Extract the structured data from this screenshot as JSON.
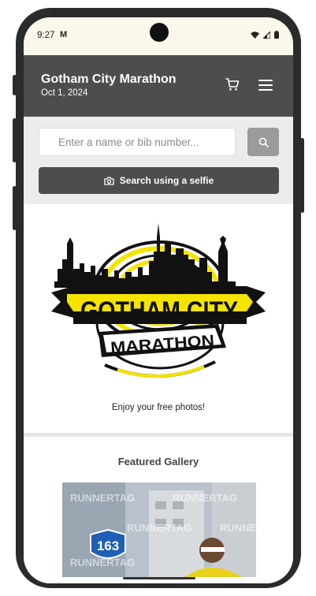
{
  "status": {
    "time": "9:27",
    "mail_icon": "M"
  },
  "header": {
    "title": "Gotham City Marathon",
    "date": "Oct 1, 2024",
    "cart_icon": "cart-icon",
    "menu_icon": "hamburger-menu-icon"
  },
  "search": {
    "placeholder": "Enter a name or bib number...",
    "value": "",
    "selfie_label": "Search using a selfie"
  },
  "hero": {
    "logo_line1": "GOTHAM CITY",
    "logo_line2": "MARATHON",
    "tagline": "Enjoy your free photos!"
  },
  "featured": {
    "title": "Featured Gallery",
    "watermark": "RUNNERTAG",
    "route_sign": "163"
  },
  "colors": {
    "header_bg": "#4d4d4d",
    "status_bg": "#fbf7ea",
    "search_area_bg": "#ececec",
    "search_button_bg": "#9b9b9b",
    "logo_yellow": "#f5e400"
  }
}
